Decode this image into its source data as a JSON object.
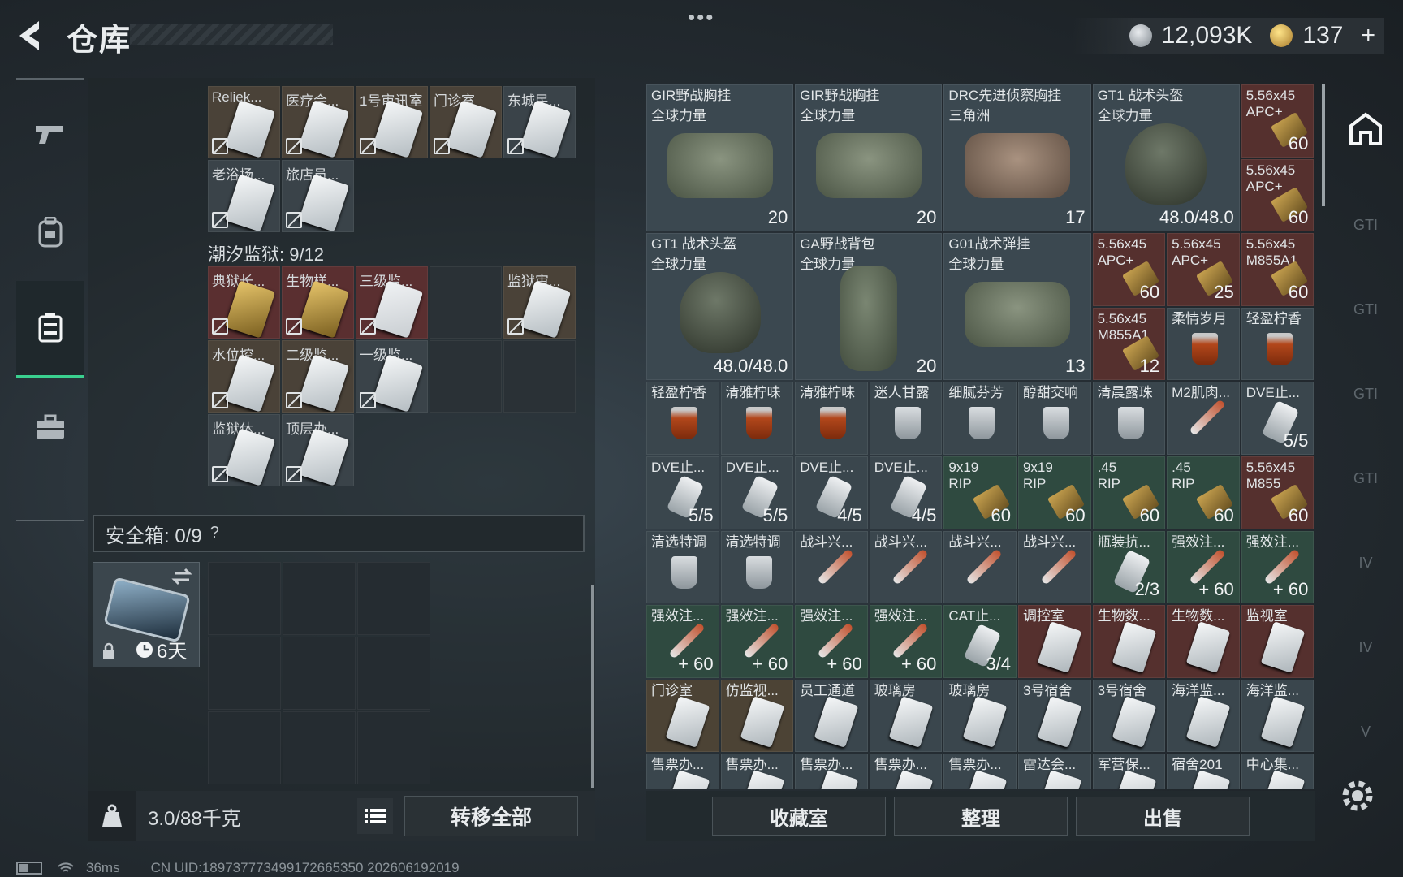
{
  "header": {
    "title": "仓库",
    "dots": "•••",
    "silver_value": "12,093K",
    "gold_value": "137",
    "gold_plus": "+"
  },
  "sidebar": {
    "items": [
      "pistol",
      "backpack",
      "locker",
      "briefcase"
    ],
    "active": 2
  },
  "keys_top": [
    {
      "label": "Reliek...",
      "color": "tan"
    },
    {
      "label": "医疗会...",
      "color": "tan"
    },
    {
      "label": "1号审讯室",
      "color": "tan"
    },
    {
      "label": "门诊室",
      "color": "tan"
    },
    {
      "label": "东城民...",
      "color": "blue"
    },
    {
      "label": "老浴场...",
      "color": "blue"
    },
    {
      "label": "旅店员...",
      "color": "blue"
    }
  ],
  "prison_label": "潮汐监狱: 9/12",
  "prison_keys": [
    {
      "label": "典狱长...",
      "color": "red",
      "card": "gold"
    },
    {
      "label": "生物样...",
      "color": "red",
      "card": "gold"
    },
    {
      "label": "三级监...",
      "color": "red",
      "card": "red"
    },
    {
      "label": "",
      "color": "empty"
    },
    {
      "label": "监狱审...",
      "color": "tan"
    },
    {
      "label": "水位控...",
      "color": "tan"
    },
    {
      "label": "二级监...",
      "color": "tan"
    },
    {
      "label": "一级监...",
      "color": "blue"
    },
    {
      "label": "",
      "color": "empty"
    },
    {
      "label": "",
      "color": "empty"
    },
    {
      "label": "监狱休...",
      "color": "blue"
    },
    {
      "label": "顶层办...",
      "color": "blue"
    }
  ],
  "safebox": {
    "label": "安全箱: 0/9",
    "help": "?",
    "timer": "6天"
  },
  "weight": {
    "value": "3.0/88千克"
  },
  "buttons": {
    "transfer_all": "转移全部",
    "collection": "收藏室",
    "organize": "整理",
    "sell": "出售"
  },
  "right_items": [
    {
      "l1": "GIR野战胸挂",
      "l2": "全球力量",
      "num": "20",
      "type": "bag",
      "span": 2
    },
    {
      "l1": "GIR野战胸挂",
      "l2": "全球力量",
      "num": "20",
      "type": "bag",
      "span": 2
    },
    {
      "l1": "DRC先进侦察胸挂",
      "l2": "三角洲",
      "num": "17",
      "type": "bagtan",
      "span": 2
    },
    {
      "l1": "GT1 战术头盔",
      "l2": "全球力量",
      "num": "48.0/48.0",
      "type": "helmet",
      "span": 2
    },
    {
      "l1": "5.56x45",
      "l2": "APC+",
      "num": "60",
      "type": "ammo",
      "color": "red"
    },
    {
      "l1": "5.56x45",
      "l2": "APC+",
      "num": "60",
      "type": "ammo",
      "color": "red"
    },
    {
      "l1": "GT1 战术头盔",
      "l2": "全球力量",
      "num": "48.0/48.0",
      "type": "helmet",
      "span": 2
    },
    {
      "l1": "GA野战背包",
      "l2": "全球力量",
      "num": "20",
      "type": "pack",
      "span": 2
    },
    {
      "l1": "G01战术弹挂",
      "l2": "全球力量",
      "num": "13",
      "type": "bag",
      "span": 2
    },
    {
      "l1": "5.56x45",
      "l2": "APC+",
      "num": "60",
      "type": "ammo",
      "color": "red"
    },
    {
      "l1": "5.56x45",
      "l2": "APC+",
      "num": "25",
      "type": "ammo",
      "color": "red"
    },
    {
      "l1": "5.56x45",
      "l2": "M855A1",
      "num": "60",
      "type": "ammo",
      "color": "red"
    },
    {
      "l1": "5.56x45",
      "l2": "M855A1",
      "num": "12",
      "type": "ammo",
      "color": "red"
    },
    {
      "l1": "柔情岁月",
      "l2": "",
      "num": "",
      "type": "glass",
      "color": "blue"
    },
    {
      "l1": "轻盈柠香",
      "l2": "",
      "num": "",
      "type": "glass",
      "color": "blue"
    },
    {
      "l1": "轻盈柠香",
      "num": "",
      "type": "glass"
    },
    {
      "l1": "清雅柠味",
      "num": "",
      "type": "glass"
    },
    {
      "l1": "清雅柠味",
      "num": "",
      "type": "glass"
    },
    {
      "l1": "迷人甘露",
      "num": "",
      "type": "glassclear"
    },
    {
      "l1": "细腻芬芳",
      "num": "",
      "type": "glassclear"
    },
    {
      "l1": "醇甜交响",
      "num": "",
      "type": "glassclear"
    },
    {
      "l1": "清晨露珠",
      "num": "",
      "type": "glassclear"
    },
    {
      "l1": "M2肌肉...",
      "num": "",
      "type": "syringe"
    },
    {
      "l1": "DVE止...",
      "num": "5/5",
      "type": "bottle"
    },
    {
      "l1": "DVE止...",
      "num": "5/5",
      "type": "bottle"
    },
    {
      "l1": "DVE止...",
      "num": "5/5",
      "type": "bottle"
    },
    {
      "l1": "DVE止...",
      "num": "4/5",
      "type": "bottle"
    },
    {
      "l1": "DVE止...",
      "num": "4/5",
      "type": "bottle"
    },
    {
      "l1": "9x19",
      "l2": "RIP",
      "num": "60",
      "type": "ammo",
      "color": "green"
    },
    {
      "l1": "9x19",
      "l2": "RIP",
      "num": "60",
      "type": "ammo",
      "color": "green"
    },
    {
      "l1": ".45",
      "l2": "RIP",
      "num": "60",
      "type": "ammo",
      "color": "green"
    },
    {
      "l1": ".45",
      "l2": "RIP",
      "num": "60",
      "type": "ammo",
      "color": "green"
    },
    {
      "l1": "5.56x45",
      "l2": "M855",
      "num": "60",
      "type": "ammo",
      "color": "red"
    },
    {
      "l1": "清选特调",
      "num": "",
      "type": "glassclear"
    },
    {
      "l1": "清选特调",
      "num": "",
      "type": "glassclear"
    },
    {
      "l1": "战斗兴...",
      "num": "",
      "type": "syringe"
    },
    {
      "l1": "战斗兴...",
      "num": "",
      "type": "syringe"
    },
    {
      "l1": "战斗兴...",
      "num": "",
      "type": "syringe"
    },
    {
      "l1": "战斗兴...",
      "num": "",
      "type": "syringe"
    },
    {
      "l1": "瓶装抗...",
      "num": "2/3",
      "type": "bottle",
      "color": "green"
    },
    {
      "l1": "强效注...",
      "num": "+ 60",
      "type": "syringe",
      "color": "green"
    },
    {
      "l1": "强效注...",
      "num": "+ 60",
      "type": "syringe",
      "color": "green"
    },
    {
      "l1": "强效注...",
      "num": "+ 60",
      "type": "syringe",
      "color": "green"
    },
    {
      "l1": "强效注...",
      "num": "+ 60",
      "type": "syringe",
      "color": "green"
    },
    {
      "l1": "强效注...",
      "num": "+ 60",
      "type": "syringe",
      "color": "green"
    },
    {
      "l1": "强效注...",
      "num": "+ 60",
      "type": "syringe",
      "color": "green"
    },
    {
      "l1": "CAT止...",
      "num": "3/4",
      "type": "bottle",
      "color": "green"
    },
    {
      "l1": "调控室",
      "num": "",
      "type": "card",
      "color": "red"
    },
    {
      "l1": "生物数...",
      "num": "",
      "type": "card",
      "color": "red"
    },
    {
      "l1": "生物数...",
      "num": "",
      "type": "card",
      "color": "red"
    },
    {
      "l1": "监视室",
      "num": "",
      "type": "card",
      "color": "red"
    },
    {
      "l1": "门诊室",
      "num": "",
      "type": "card",
      "color": "tan"
    },
    {
      "l1": "仿监视...",
      "num": "",
      "type": "card",
      "color": "tan"
    },
    {
      "l1": "员工通道",
      "num": "",
      "type": "card",
      "color": "blue"
    },
    {
      "l1": "玻璃房",
      "num": "",
      "type": "card",
      "color": "blue"
    },
    {
      "l1": "玻璃房",
      "num": "",
      "type": "card",
      "color": "blue"
    },
    {
      "l1": "3号宿舍",
      "num": "",
      "type": "card",
      "color": "blue"
    },
    {
      "l1": "3号宿舍",
      "num": "",
      "type": "card",
      "color": "blue"
    },
    {
      "l1": "海洋监...",
      "num": "",
      "type": "card",
      "color": "blue"
    },
    {
      "l1": "海洋监...",
      "num": "",
      "type": "card",
      "color": "blue"
    },
    {
      "l1": "售票办...",
      "num": "",
      "type": "card",
      "color": "blue"
    },
    {
      "l1": "售票办...",
      "num": "",
      "type": "card",
      "color": "blue"
    },
    {
      "l1": "售票办...",
      "num": "",
      "type": "card",
      "color": "blue"
    },
    {
      "l1": "售票办...",
      "num": "",
      "type": "card",
      "color": "blue"
    },
    {
      "l1": "售票办...",
      "num": "",
      "type": "card",
      "color": "blue"
    },
    {
      "l1": "雷达会...",
      "num": "",
      "type": "card",
      "color": "blue"
    },
    {
      "l1": "军营保...",
      "num": "",
      "type": "card",
      "color": "blue"
    },
    {
      "l1": "宿舍201",
      "num": "",
      "type": "card",
      "color": "blue"
    },
    {
      "l1": "中心集...",
      "num": "",
      "type": "card",
      "color": "blue"
    }
  ],
  "right_side": [
    "GTI",
    "GTI",
    "GTI",
    "GTI",
    "IV",
    "IV",
    "V"
  ],
  "status": {
    "ping": "36ms",
    "uid": "CN UID:1897377734991726653​50 202606192019"
  }
}
